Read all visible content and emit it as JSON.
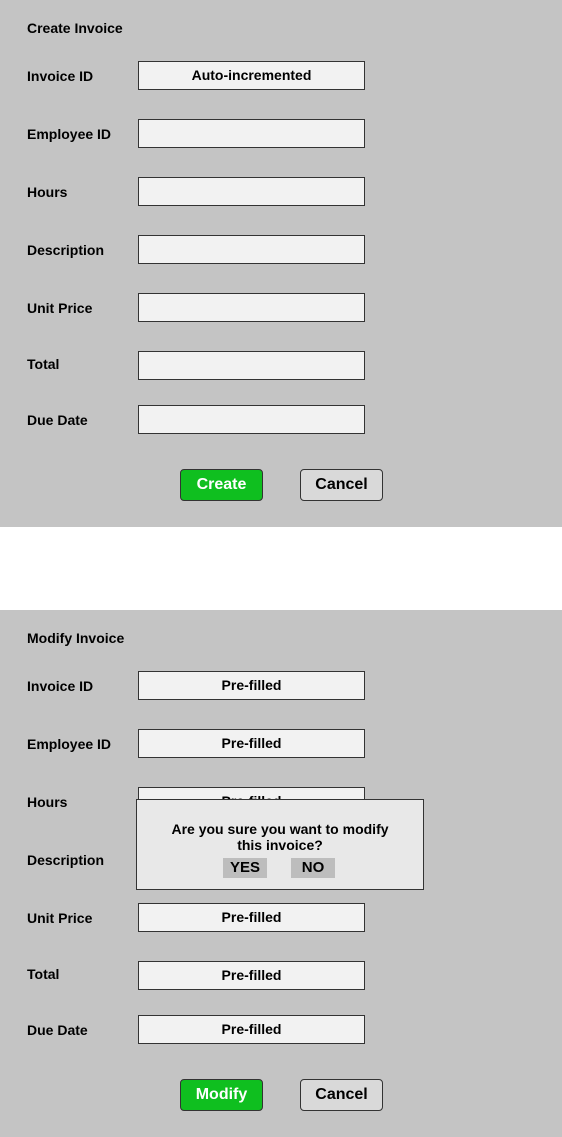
{
  "create": {
    "title": "Create Invoice",
    "fields": [
      {
        "label": "Invoice ID",
        "value": "Auto-incremented"
      },
      {
        "label": "Employee ID",
        "value": ""
      },
      {
        "label": "Hours",
        "value": ""
      },
      {
        "label": "Description",
        "value": ""
      },
      {
        "label": "Unit Price",
        "value": ""
      },
      {
        "label": "Total",
        "value": ""
      },
      {
        "label": "Due Date",
        "value": ""
      }
    ],
    "primary_label": "Create",
    "cancel_label": "Cancel"
  },
  "modify": {
    "title": "Modify Invoice",
    "fields": [
      {
        "label": "Invoice ID",
        "value": "Pre-filled"
      },
      {
        "label": "Employee ID",
        "value": "Pre-filled"
      },
      {
        "label": "Hours",
        "value": "Pre-filled"
      },
      {
        "label": "Description",
        "value": ""
      },
      {
        "label": "Unit Price",
        "value": "Pre-filled"
      },
      {
        "label": "Total",
        "value": "Pre-filled"
      },
      {
        "label": "Due Date",
        "value": "Pre-filled"
      }
    ],
    "primary_label": "Modify",
    "cancel_label": "Cancel",
    "dialog": {
      "message_line1": "Are you sure you want to modify",
      "message_line2": "this invoice?",
      "yes_label": "YES",
      "no_label": "NO"
    }
  },
  "colors": {
    "panel_bg": "#c4c4c4",
    "field_bg": "#f2f2f2",
    "primary_green": "#0fbf1f",
    "dialog_bg": "#e8e8e8"
  }
}
